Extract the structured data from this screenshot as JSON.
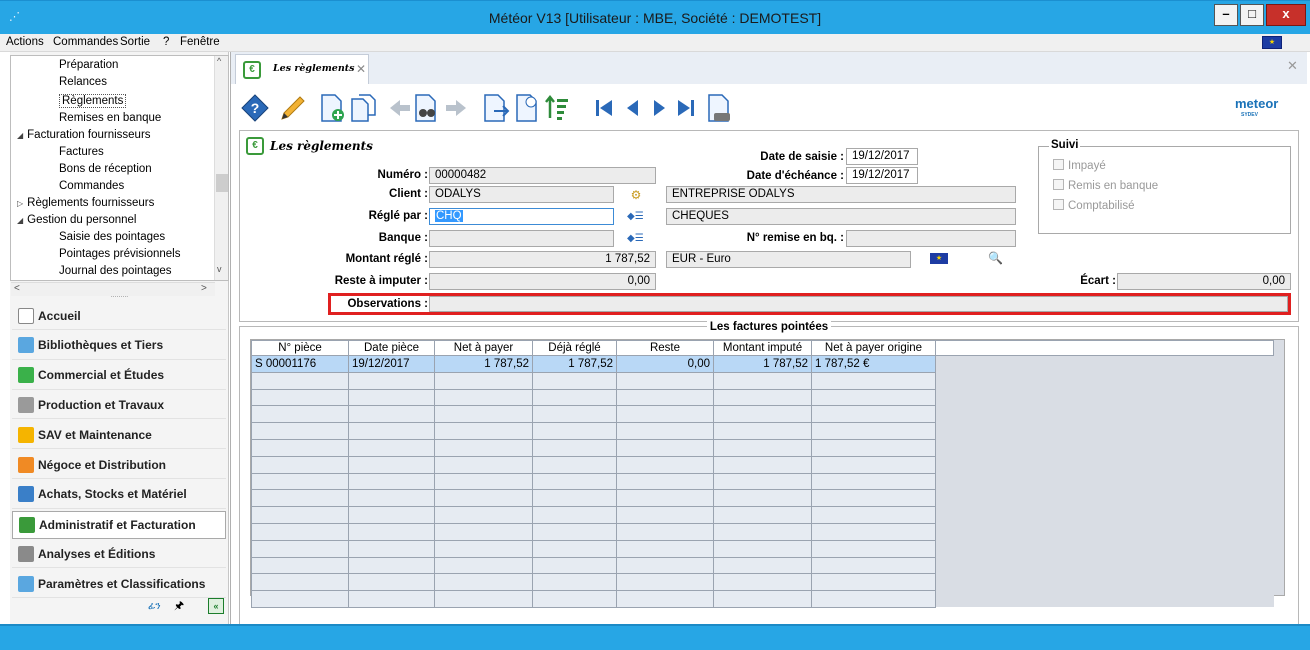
{
  "window": {
    "title": "Météor V13 [Utilisateur : MBE, Société : DEMOTEST]",
    "min": "–",
    "max": "□",
    "close": "x"
  },
  "menu": [
    "Actions",
    "Commandes",
    "Sortie",
    "?",
    "Fenêtre"
  ],
  "tree": [
    {
      "label": "Préparation",
      "level": 2
    },
    {
      "label": "Relances",
      "level": 2
    },
    {
      "label": "Règlements",
      "level": 2,
      "selected": true
    },
    {
      "label": "Remises en banque",
      "level": 2
    },
    {
      "label": "Facturation fournisseurs",
      "level": 1,
      "expander": "◢"
    },
    {
      "label": "Factures",
      "level": 2
    },
    {
      "label": "Bons de réception",
      "level": 2
    },
    {
      "label": "Commandes",
      "level": 2
    },
    {
      "label": "Règlements fournisseurs",
      "level": 1,
      "expander": "▷"
    },
    {
      "label": "Gestion du personnel",
      "level": 1,
      "expander": "◢"
    },
    {
      "label": "Saisie des pointages",
      "level": 2
    },
    {
      "label": "Pointages prévisionnels",
      "level": 2
    },
    {
      "label": "Journal des pointages",
      "level": 2
    }
  ],
  "nav": [
    {
      "label": "Accueil",
      "color": "#ffffff",
      "icon": "home-icon"
    },
    {
      "label": "Bibliothèques et Tiers",
      "color": "#5aa7e0",
      "icon": "library-icon"
    },
    {
      "label": "Commercial et Études",
      "color": "#3ab14a",
      "icon": "commercial-icon"
    },
    {
      "label": "Production et Travaux",
      "color": "#9a9a9a",
      "icon": "production-icon"
    },
    {
      "label": "SAV et Maintenance",
      "color": "#f5b400",
      "icon": "tools-icon"
    },
    {
      "label": "Négoce et Distribution",
      "color": "#f08a24",
      "icon": "handshake-icon"
    },
    {
      "label": "Achats, Stocks et Matériel",
      "color": "#3a7fc8",
      "icon": "cart-icon"
    },
    {
      "label": "Administratif et Facturation",
      "color": "#3a9a3a",
      "icon": "admin-icon",
      "active": true
    },
    {
      "label": "Analyses et Éditions",
      "color": "#8a8a8a",
      "icon": "chart-icon"
    },
    {
      "label": "Paramètres et Classifications",
      "color": "#5aa7e0",
      "icon": "settings-icon"
    }
  ],
  "sidebar_bottom": {
    "logo_glyph": "ፊን",
    "pin_glyph": "🖈",
    "collapse_glyph": "«"
  },
  "tab": {
    "label": "Les règlements",
    "close": "✕"
  },
  "strip_close": "✕",
  "brand": {
    "name": "meteor",
    "sub": "SYDEV"
  },
  "form": {
    "title": "Les règlements",
    "numero_label": "Numéro :",
    "numero": "00000482",
    "date_saisie_label": "Date de saisie :",
    "date_saisie": "19/12/2017",
    "date_echeance_label": "Date d'échéance :",
    "date_echeance": "19/12/2017",
    "client_label": "Client :",
    "client_code": "ODALYS",
    "client_name": "ENTREPRISE ODALYS",
    "regle_par_label": "Réglé par :",
    "regle_par": "CHQ",
    "regle_par_name": "CHEQUES",
    "banque_label": "Banque :",
    "banque": "",
    "no_remise_label": "N° remise en bq. :",
    "no_remise": "",
    "montant_label": "Montant réglé :",
    "montant": "1 787,52",
    "devise": "EUR - Euro",
    "reste_label": "Reste à imputer :",
    "reste": "0,00",
    "ecart_label": "Écart :",
    "ecart": "0,00",
    "observations_label": "Observations :",
    "observations": ""
  },
  "suivi": {
    "title": "Suivi",
    "items": [
      "Impayé",
      "Remis en banque",
      "Comptabilisé"
    ]
  },
  "factures": {
    "title": "Les factures pointées",
    "columns": [
      "N° pièce",
      "Date pièce",
      "Net à payer",
      "Déjà réglé",
      "Reste",
      "Montant imputé",
      "Net à payer origine"
    ],
    "rows": [
      [
        "S 00001176",
        "19/12/2017",
        "1 787,52",
        "1 787,52",
        "0,00",
        "1 787,52",
        "1 787,52 €"
      ]
    ],
    "empty_rows": 14
  }
}
